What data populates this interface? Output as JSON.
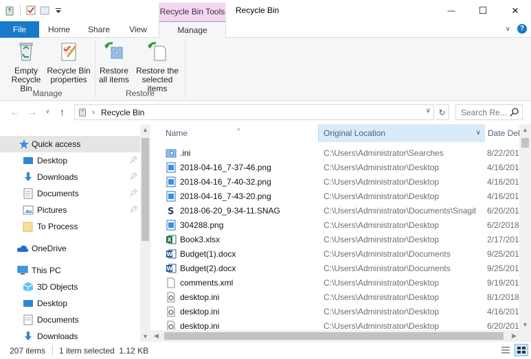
{
  "window": {
    "title": "Recycle Bin",
    "contextual_tab": "Recycle Bin Tools",
    "minimize_glyph": "—",
    "maximize_glyph": "☐",
    "close_glyph": "✕"
  },
  "ribbon_tabs": {
    "file": "File",
    "home": "Home",
    "share": "Share",
    "view": "View",
    "manage": "Manage"
  },
  "ribbon": {
    "manage_group": {
      "label": "Manage",
      "empty_bin": [
        "Empty",
        "Recycle Bin"
      ],
      "properties": [
        "Recycle Bin",
        "properties"
      ]
    },
    "restore_group": {
      "label": "Restore",
      "restore_all": [
        "Restore",
        "all items"
      ],
      "restore_selected": [
        "Restore the",
        "selected items"
      ]
    }
  },
  "address": {
    "crumb": "Recycle Bin",
    "search_placeholder": "Search Re..."
  },
  "nav_pane": {
    "items": [
      {
        "label": "Quick access",
        "icon": "star-icon"
      },
      {
        "label": "Desktop",
        "icon": "desktop-icon"
      },
      {
        "label": "Downloads",
        "icon": "downloads-icon"
      },
      {
        "label": "Documents",
        "icon": "documents-icon"
      },
      {
        "label": "Pictures",
        "icon": "pictures-icon"
      },
      {
        "label": "To Process",
        "icon": "folder-icon"
      },
      {
        "label": "OneDrive",
        "icon": "cloud-icon"
      },
      {
        "label": "This PC",
        "icon": "pc-icon"
      },
      {
        "label": "3D Objects",
        "icon": "cube-icon"
      },
      {
        "label": "Desktop",
        "icon": "desktop-icon"
      },
      {
        "label": "Documents",
        "icon": "documents-icon"
      },
      {
        "label": "Downloads",
        "icon": "downloads-icon"
      }
    ]
  },
  "file_list": {
    "columns": {
      "name": "Name",
      "original_location": "Original Location",
      "date_deleted": "Date Del"
    },
    "rows": [
      {
        "name": ".ini",
        "location": "C:\\Users\\Administrator\\Searches",
        "date": "8/22/201",
        "icon": "search-folder-icon"
      },
      {
        "name": "2018-04-16_7-37-46.png",
        "location": "C:\\Users\\Administrator\\Desktop",
        "date": "4/16/201",
        "icon": "image-file-icon"
      },
      {
        "name": "2018-04-16_7-40-32.png",
        "location": "C:\\Users\\Administrator\\Desktop",
        "date": "4/16/201",
        "icon": "image-file-icon"
      },
      {
        "name": "2018-04-16_7-43-20.png",
        "location": "C:\\Users\\Administrator\\Desktop",
        "date": "4/16/201",
        "icon": "image-file-icon"
      },
      {
        "name": "2018-06-20_9-34-11.SNAG",
        "location": "C:\\Users\\Administrator\\Documents\\Snagit",
        "date": "6/20/201",
        "icon": "snagit-file-icon"
      },
      {
        "name": "304288.png",
        "location": "C:\\Users\\Administrator\\Desktop",
        "date": "6/2/2018",
        "icon": "image-file-icon"
      },
      {
        "name": "Book3.xlsx",
        "location": "C:\\Users\\Administrator\\Desktop",
        "date": "2/17/201",
        "icon": "excel-file-icon"
      },
      {
        "name": "Budget(1).docx",
        "location": "C:\\Users\\Administrator\\Documents",
        "date": "9/25/201",
        "icon": "word-file-icon"
      },
      {
        "name": "Budget(2).docx",
        "location": "C:\\Users\\Administrator\\Documents",
        "date": "9/25/201",
        "icon": "word-file-icon"
      },
      {
        "name": "comments.xml",
        "location": "C:\\Users\\Administrator\\Desktop",
        "date": "9/19/201",
        "icon": "xml-file-icon"
      },
      {
        "name": "desktop.ini",
        "location": "C:\\Users\\Administrator\\Desktop",
        "date": "8/1/2018",
        "icon": "settings-file-icon"
      },
      {
        "name": "desktop.ini",
        "location": "C:\\Users\\Administrator\\Desktop",
        "date": "4/16/201",
        "icon": "settings-file-icon"
      },
      {
        "name": "desktop.ini",
        "location": "C:\\Users\\Administrator\\Desktop",
        "date": "6/20/201",
        "icon": "settings-file-icon"
      }
    ]
  },
  "status": {
    "item_count": "207 items",
    "selection": "1 item selected  1.12 KB"
  },
  "colors": {
    "file_tab": "#1979ca",
    "contextual": "#f3d7f1",
    "selected_nav": "#e5e5e5",
    "column_highlight": "#d9ebf9"
  }
}
